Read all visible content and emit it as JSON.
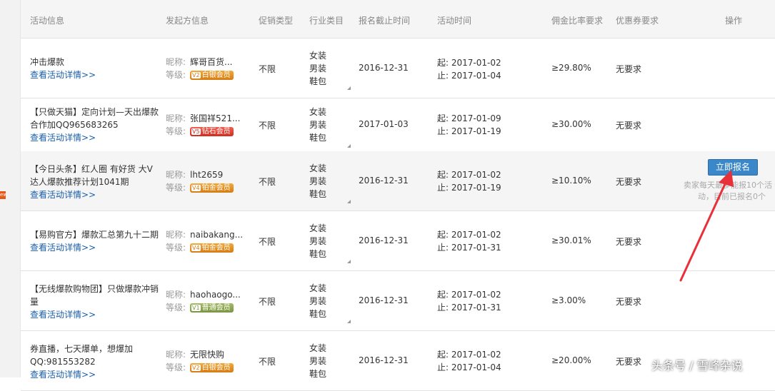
{
  "header": {
    "col_info": "活动信息",
    "col_organizer": "发起方信息",
    "col_promo": "促销类型",
    "col_industry": "行业类目",
    "col_deadline": "报名截止时间",
    "col_time": "活动时间",
    "col_commission": "佣金比率要求",
    "col_coupon": "优惠券要求",
    "col_action": "操作"
  },
  "labels": {
    "nickname": "昵称:",
    "level": "等级:",
    "start": "起:",
    "end": "止:",
    "detail_link": "查看活动详情>>"
  },
  "rows": [
    {
      "title": "冲击爆款",
      "nickname": "辉哥百货...",
      "level_icon": "V2",
      "level": "白银会员",
      "promo": "不限",
      "cats": [
        "女装",
        "男装",
        "鞋包"
      ],
      "deadline": "2016-12-31",
      "start": "2017-01-02",
      "end": "2017-01-04",
      "commission": "≥29.80%",
      "coupon": "无要求"
    },
    {
      "title": "【只做天猫】定向计划—天出爆款合作加QQ965683265",
      "nickname": "张国祥521...",
      "level_icon": "V5",
      "level": "钻石会员",
      "promo": "不限",
      "cats": [
        "女装",
        "男装",
        "鞋包"
      ],
      "deadline": "2017-01-03",
      "start": "2017-01-09",
      "end": "2017-01-19",
      "commission": "≥30.00%",
      "coupon": "无要求"
    },
    {
      "title": "【今日头条】红人圈 有好货 大V达人爆款推荐计划1041期",
      "nickname": "lht2659",
      "level_icon": "V4",
      "level": "铂金会员",
      "promo": "不限",
      "cats": [
        "女装",
        "男装",
        "鞋包"
      ],
      "deadline": "2016-12-31",
      "start": "2017-01-02",
      "end": "2017-01-19",
      "commission": "≥10.10%",
      "coupon": "无要求"
    },
    {
      "title": "【易购官方】爆款汇总第九十二期",
      "nickname": "naibakang...",
      "level_icon": "V4",
      "level": "铂金会员",
      "promo": "不限",
      "cats": [
        "女装",
        "男装",
        "鞋包"
      ],
      "deadline": "2016-12-31",
      "start": "2017-01-02",
      "end": "2017-01-31",
      "commission": "≥30.01%",
      "coupon": "无要求"
    },
    {
      "title": "【无线爆款购物团】只做爆款冲销量",
      "nickname": "haohaogo...",
      "level_icon": "V1",
      "level": "普通会员",
      "promo": "不限",
      "cats": [
        "女装",
        "男装",
        "鞋包"
      ],
      "deadline": "2016-12-31",
      "start": "2017-01-02",
      "end": "2017-01-31",
      "commission": "≥3.00%",
      "coupon": "无要求"
    },
    {
      "title": "券直播，七天爆单，想爆加QQ:981553282",
      "nickname": "无限快购",
      "level_icon": "V2",
      "level": "白银会员",
      "promo": "不限",
      "cats": [
        "女装",
        "男装",
        "鞋包"
      ],
      "deadline": "2016-12-31",
      "start": "2017-01-02",
      "end": "2017-01-04",
      "commission": "≥20.00%",
      "coupon": "无要求"
    }
  ],
  "action": {
    "signup_label": "立即报名",
    "note_line1": "卖家每天最多能报10个活",
    "note_line2": "动，目前已报名0个"
  },
  "edge_tag": "ew",
  "watermark": "头条号 / 雪峰杂说",
  "colors": {
    "link": "#1a5ea8",
    "button": "#3a87c9",
    "arrow": "#e8303a"
  }
}
